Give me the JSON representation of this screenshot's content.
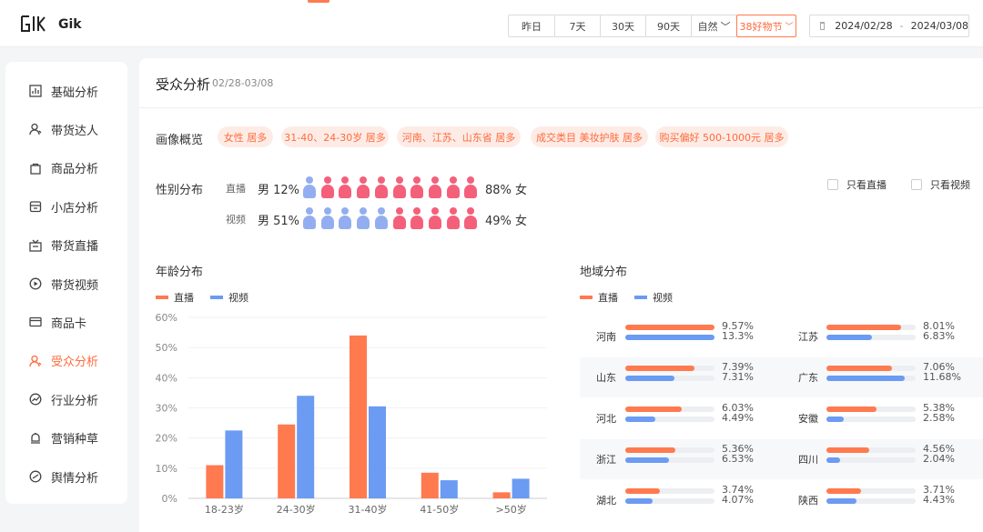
{
  "header": {
    "brand": "Gik",
    "range_buttons": [
      "昨日",
      "7天",
      "30天",
      "90天"
    ],
    "flow_select": "自然",
    "event_select": "38好物节",
    "date_start": "2024/02/28",
    "date_sep": "-",
    "date_end": "2024/03/08"
  },
  "sidebar": {
    "items": [
      {
        "label": "基础分析",
        "icon": "bar-chart-icon",
        "active": false
      },
      {
        "label": "带货达人",
        "icon": "user-icon",
        "active": false
      },
      {
        "label": "商品分析",
        "icon": "shopping-bag-icon",
        "active": false
      },
      {
        "label": "小店分析",
        "icon": "store-icon",
        "active": false
      },
      {
        "label": "带货直播",
        "icon": "live-tv-icon",
        "active": false
      },
      {
        "label": "带货视频",
        "icon": "play-icon",
        "active": false
      },
      {
        "label": "商品卡",
        "icon": "card-icon",
        "active": false
      },
      {
        "label": "受众分析",
        "icon": "user-icon",
        "active": true
      },
      {
        "label": "行业分析",
        "icon": "trend-icon",
        "active": false
      },
      {
        "label": "营销种草",
        "icon": "sprout-icon",
        "active": false
      },
      {
        "label": "舆情分析",
        "icon": "pulse-icon",
        "active": false
      }
    ]
  },
  "main": {
    "title": "受众分析",
    "subtitle": "02/28-03/08",
    "portrait_label": "画像概览",
    "tags": [
      "女性 居多",
      "31-40、24-30岁 居多",
      "河南、江苏、山东省 居多",
      "成交类目 美妆护肤 居多",
      "购买偏好 500-1000元 居多"
    ],
    "gender": {
      "label": "性别分布",
      "rows": [
        {
          "name": "直播",
          "male": "男 12%",
          "female": "88% 女",
          "male_icons": 1,
          "total_icons": 10
        },
        {
          "name": "视频",
          "male": "男 51%",
          "female": "49% 女",
          "male_icons": 5,
          "total_icons": 10
        }
      ],
      "filters": [
        "只看直播",
        "只看视频"
      ]
    },
    "age": {
      "label": "年龄分布",
      "legend": [
        "直播",
        "视频"
      ]
    },
    "region": {
      "label": "地域分布",
      "legend": [
        "直播",
        "视频"
      ],
      "max_live": 9.57,
      "max_video": 13.3,
      "rows": [
        [
          {
            "name": "河南",
            "live": 9.57,
            "video": 13.3,
            "live_text": "9.57%",
            "video_text": "13.3%"
          },
          {
            "name": "江苏",
            "live": 8.01,
            "video": 6.83,
            "live_text": "8.01%",
            "video_text": "6.83%"
          }
        ],
        [
          {
            "name": "山东",
            "live": 7.39,
            "video": 7.31,
            "live_text": "7.39%",
            "video_text": "7.31%"
          },
          {
            "name": "广东",
            "live": 7.06,
            "video": 11.68,
            "live_text": "7.06%",
            "video_text": "11.68%"
          }
        ],
        [
          {
            "name": "河北",
            "live": 6.03,
            "video": 4.49,
            "live_text": "6.03%",
            "video_text": "4.49%"
          },
          {
            "name": "安徽",
            "live": 5.38,
            "video": 2.58,
            "live_text": "5.38%",
            "video_text": "2.58%"
          }
        ],
        [
          {
            "name": "浙江",
            "live": 5.36,
            "video": 6.53,
            "live_text": "5.36%",
            "video_text": "6.53%"
          },
          {
            "name": "四川",
            "live": 4.56,
            "video": 2.04,
            "live_text": "4.56%",
            "video_text": "2.04%"
          }
        ],
        [
          {
            "name": "湖北",
            "live": 3.74,
            "video": 4.07,
            "live_text": "3.74%",
            "video_text": "4.07%"
          },
          {
            "name": "陕西",
            "live": 3.71,
            "video": 4.43,
            "live_text": "3.71%",
            "video_text": "4.43%"
          }
        ]
      ]
    }
  },
  "colors": {
    "accent": "#ff6a3d",
    "live": "#ff7a4f",
    "video": "#6b9bf2",
    "male": "#93aef0",
    "female": "#f4607a"
  },
  "chart_data": {
    "type": "bar",
    "categories": [
      "18-23岁",
      "24-30岁",
      "31-40岁",
      "41-50岁",
      ">50岁"
    ],
    "series": [
      {
        "name": "直播",
        "values": [
          11,
          24.5,
          54,
          8.5,
          2
        ]
      },
      {
        "name": "视频",
        "values": [
          22.5,
          34,
          30.5,
          6,
          6.5
        ]
      }
    ],
    "yticks": [
      "0%",
      "10%",
      "20%",
      "30%",
      "40%",
      "50%",
      "60%"
    ],
    "ylim": [
      0,
      60
    ],
    "grid": true
  }
}
